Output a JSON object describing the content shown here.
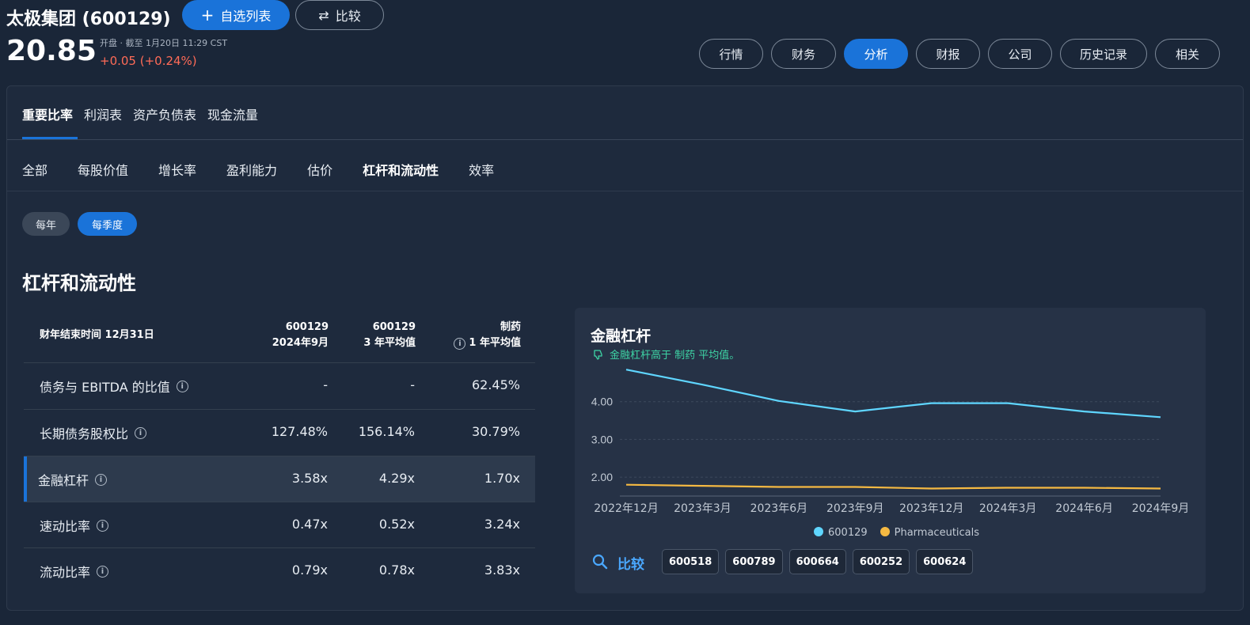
{
  "header": {
    "title": "太极集团 (600129)",
    "watchlist_label": "自选列表",
    "compare_label": "比较",
    "price": "20.85",
    "status": "开盘 · 截至 1月20日 11:29 CST",
    "change": "+0.05 (+0.24%)"
  },
  "nav": [
    "行情",
    "财务",
    "分析",
    "财报",
    "公司",
    "历史记录",
    "相关"
  ],
  "nav_active": "分析",
  "tabs_primary": [
    "重要比率",
    "利润表",
    "资产负债表",
    "现金流量"
  ],
  "tabs_secondary": [
    "全部",
    "每股价值",
    "增长率",
    "盈利能力",
    "估价",
    "杠杆和流动性",
    "效率"
  ],
  "period": {
    "annual": "每年",
    "quarterly": "每季度"
  },
  "section_title": "杠杆和流动性",
  "table": {
    "header_label": "财年结束时间 12月31日",
    "col1": [
      "600129",
      "2024年9月"
    ],
    "col2": [
      "600129",
      "3 年平均值"
    ],
    "col3": [
      "制药",
      "1 年平均值"
    ],
    "rows": [
      {
        "label": "债务与 EBITDA 的比值",
        "v1": "-",
        "v2": "-",
        "v3": "62.45%"
      },
      {
        "label": "长期债务股权比",
        "v1": "127.48%",
        "v2": "156.14%",
        "v3": "30.79%"
      },
      {
        "label": "金融杠杆",
        "v1": "3.58x",
        "v2": "4.29x",
        "v3": "1.70x"
      },
      {
        "label": "速动比率",
        "v1": "0.47x",
        "v2": "0.52x",
        "v3": "3.24x"
      },
      {
        "label": "流动比率",
        "v1": "0.79x",
        "v2": "0.78x",
        "v3": "3.83x"
      }
    ]
  },
  "chart": {
    "title": "金融杠杆",
    "subtitle": "金融杠杆高于 制药 平均值。",
    "compare_label": "比较",
    "compare_tickers": [
      "600518",
      "600789",
      "600664",
      "600252",
      "600624"
    ]
  },
  "chart_data": {
    "type": "line",
    "x": [
      "2022年12月",
      "2023年3月",
      "2023年6月",
      "2023年9月",
      "2023年12月",
      "2024年3月",
      "2024年6月",
      "2024年9月"
    ],
    "y_ticks": [
      "2.00",
      "3.00",
      "4.00"
    ],
    "ylim": [
      1.5,
      5.0
    ],
    "grid": true,
    "legend_position": "bottom",
    "series": [
      {
        "name": "600129",
        "color": "#5fd6ff",
        "values": [
          4.85,
          4.45,
          4.02,
          3.74,
          3.96,
          3.96,
          3.74,
          3.59
        ]
      },
      {
        "name": "Pharmaceuticals",
        "color": "#f5b942",
        "values": [
          1.8,
          1.77,
          1.74,
          1.74,
          1.7,
          1.72,
          1.72,
          1.7
        ]
      }
    ]
  }
}
